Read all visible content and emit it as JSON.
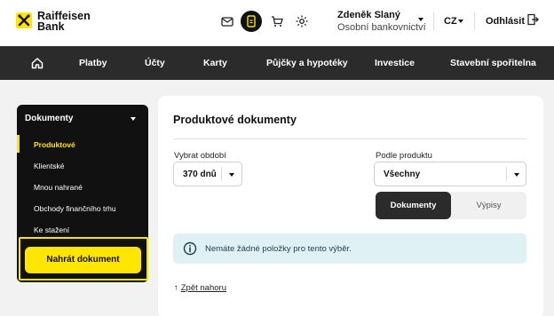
{
  "brand": {
    "line1": "Raiffeisen",
    "line2": "Bank",
    "accent": "#fee600"
  },
  "header": {
    "icons": [
      "mail-icon",
      "mobile-doc-icon",
      "cart-icon",
      "settings-icon"
    ],
    "user_name": "Zdeněk Slaný",
    "account_type": "Osobní bankovnictví",
    "language": "CZ",
    "logout_label": "Odhlásit"
  },
  "nav": {
    "items": [
      "Platby",
      "Účty",
      "Karty",
      "Půjčky a hypotéky",
      "Investice",
      "Stavební spořitelna"
    ]
  },
  "sidebar": {
    "heading": "Dokumenty",
    "items": [
      "Produktové",
      "Klientské",
      "Mnou nahrané",
      "Obchody finančního trhu",
      "Ke stažení"
    ],
    "active_item": "Produktové",
    "upload_label": "Nahrát dokument"
  },
  "main": {
    "title": "Produktové dokumenty",
    "period_label": "Vybrat období",
    "period_value": "370 dnů",
    "product_label": "Podle produktu",
    "product_value": "Všechny",
    "tabs": [
      "Dokumenty",
      "Výpisy"
    ],
    "active_tab": "Dokumenty",
    "info_message": "Nemáte žádné položky pro tento výběr.",
    "back_label": "Zpět nahoru",
    "back_arrow": "↑"
  }
}
